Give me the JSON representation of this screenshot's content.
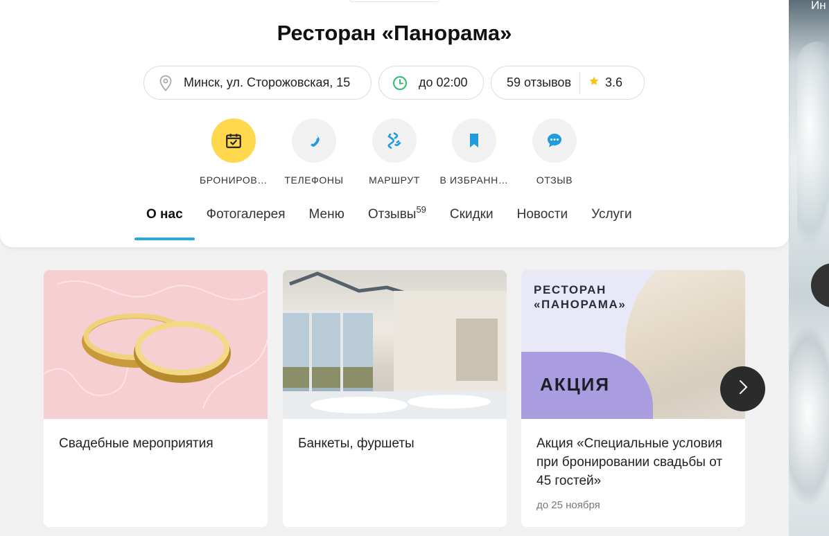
{
  "header": {
    "title": "Ресторан «Панорама»",
    "address": "Минск, ул. Сторожовская, 15",
    "hours": "до 02:00",
    "reviews_count": "59 отзывов",
    "rating": "3.6"
  },
  "actions": [
    {
      "label": "БРОНИРОВ…",
      "icon": "calendar-check-icon"
    },
    {
      "label": "ТЕЛЕФОНЫ",
      "icon": "phone-icon"
    },
    {
      "label": "МАРШРУТ",
      "icon": "route-icon"
    },
    {
      "label": "В ИЗБРАНН…",
      "icon": "bookmark-icon"
    },
    {
      "label": "ОТЗЫВ",
      "icon": "chat-bubble-icon"
    }
  ],
  "tabs": [
    {
      "label": "О нас",
      "active": true
    },
    {
      "label": "Фотогалерея"
    },
    {
      "label": "Меню"
    },
    {
      "label": "Отзывы",
      "badge": "59"
    },
    {
      "label": "Скидки"
    },
    {
      "label": "Новости"
    },
    {
      "label": "Услуги"
    }
  ],
  "cards": [
    {
      "title": "Свадебные мероприятия",
      "image": "wedding-rings"
    },
    {
      "title": "Банкеты, фуршеты",
      "image": "banquet-hall"
    },
    {
      "title": "Акция «Специальные условия при бронировании свадьбы от 45 гостей»",
      "date": "до 25 ноября",
      "promo_brand": "РЕСТОРАН\n«ПАНОРАМА»",
      "promo_tag": "АКЦИЯ"
    }
  ],
  "side": {
    "cut_text": "Ин"
  },
  "colors": {
    "accent": "#2aa7e0",
    "booking": "#ffd84d",
    "star": "#f5c518",
    "clock": "#2dbe6c"
  }
}
